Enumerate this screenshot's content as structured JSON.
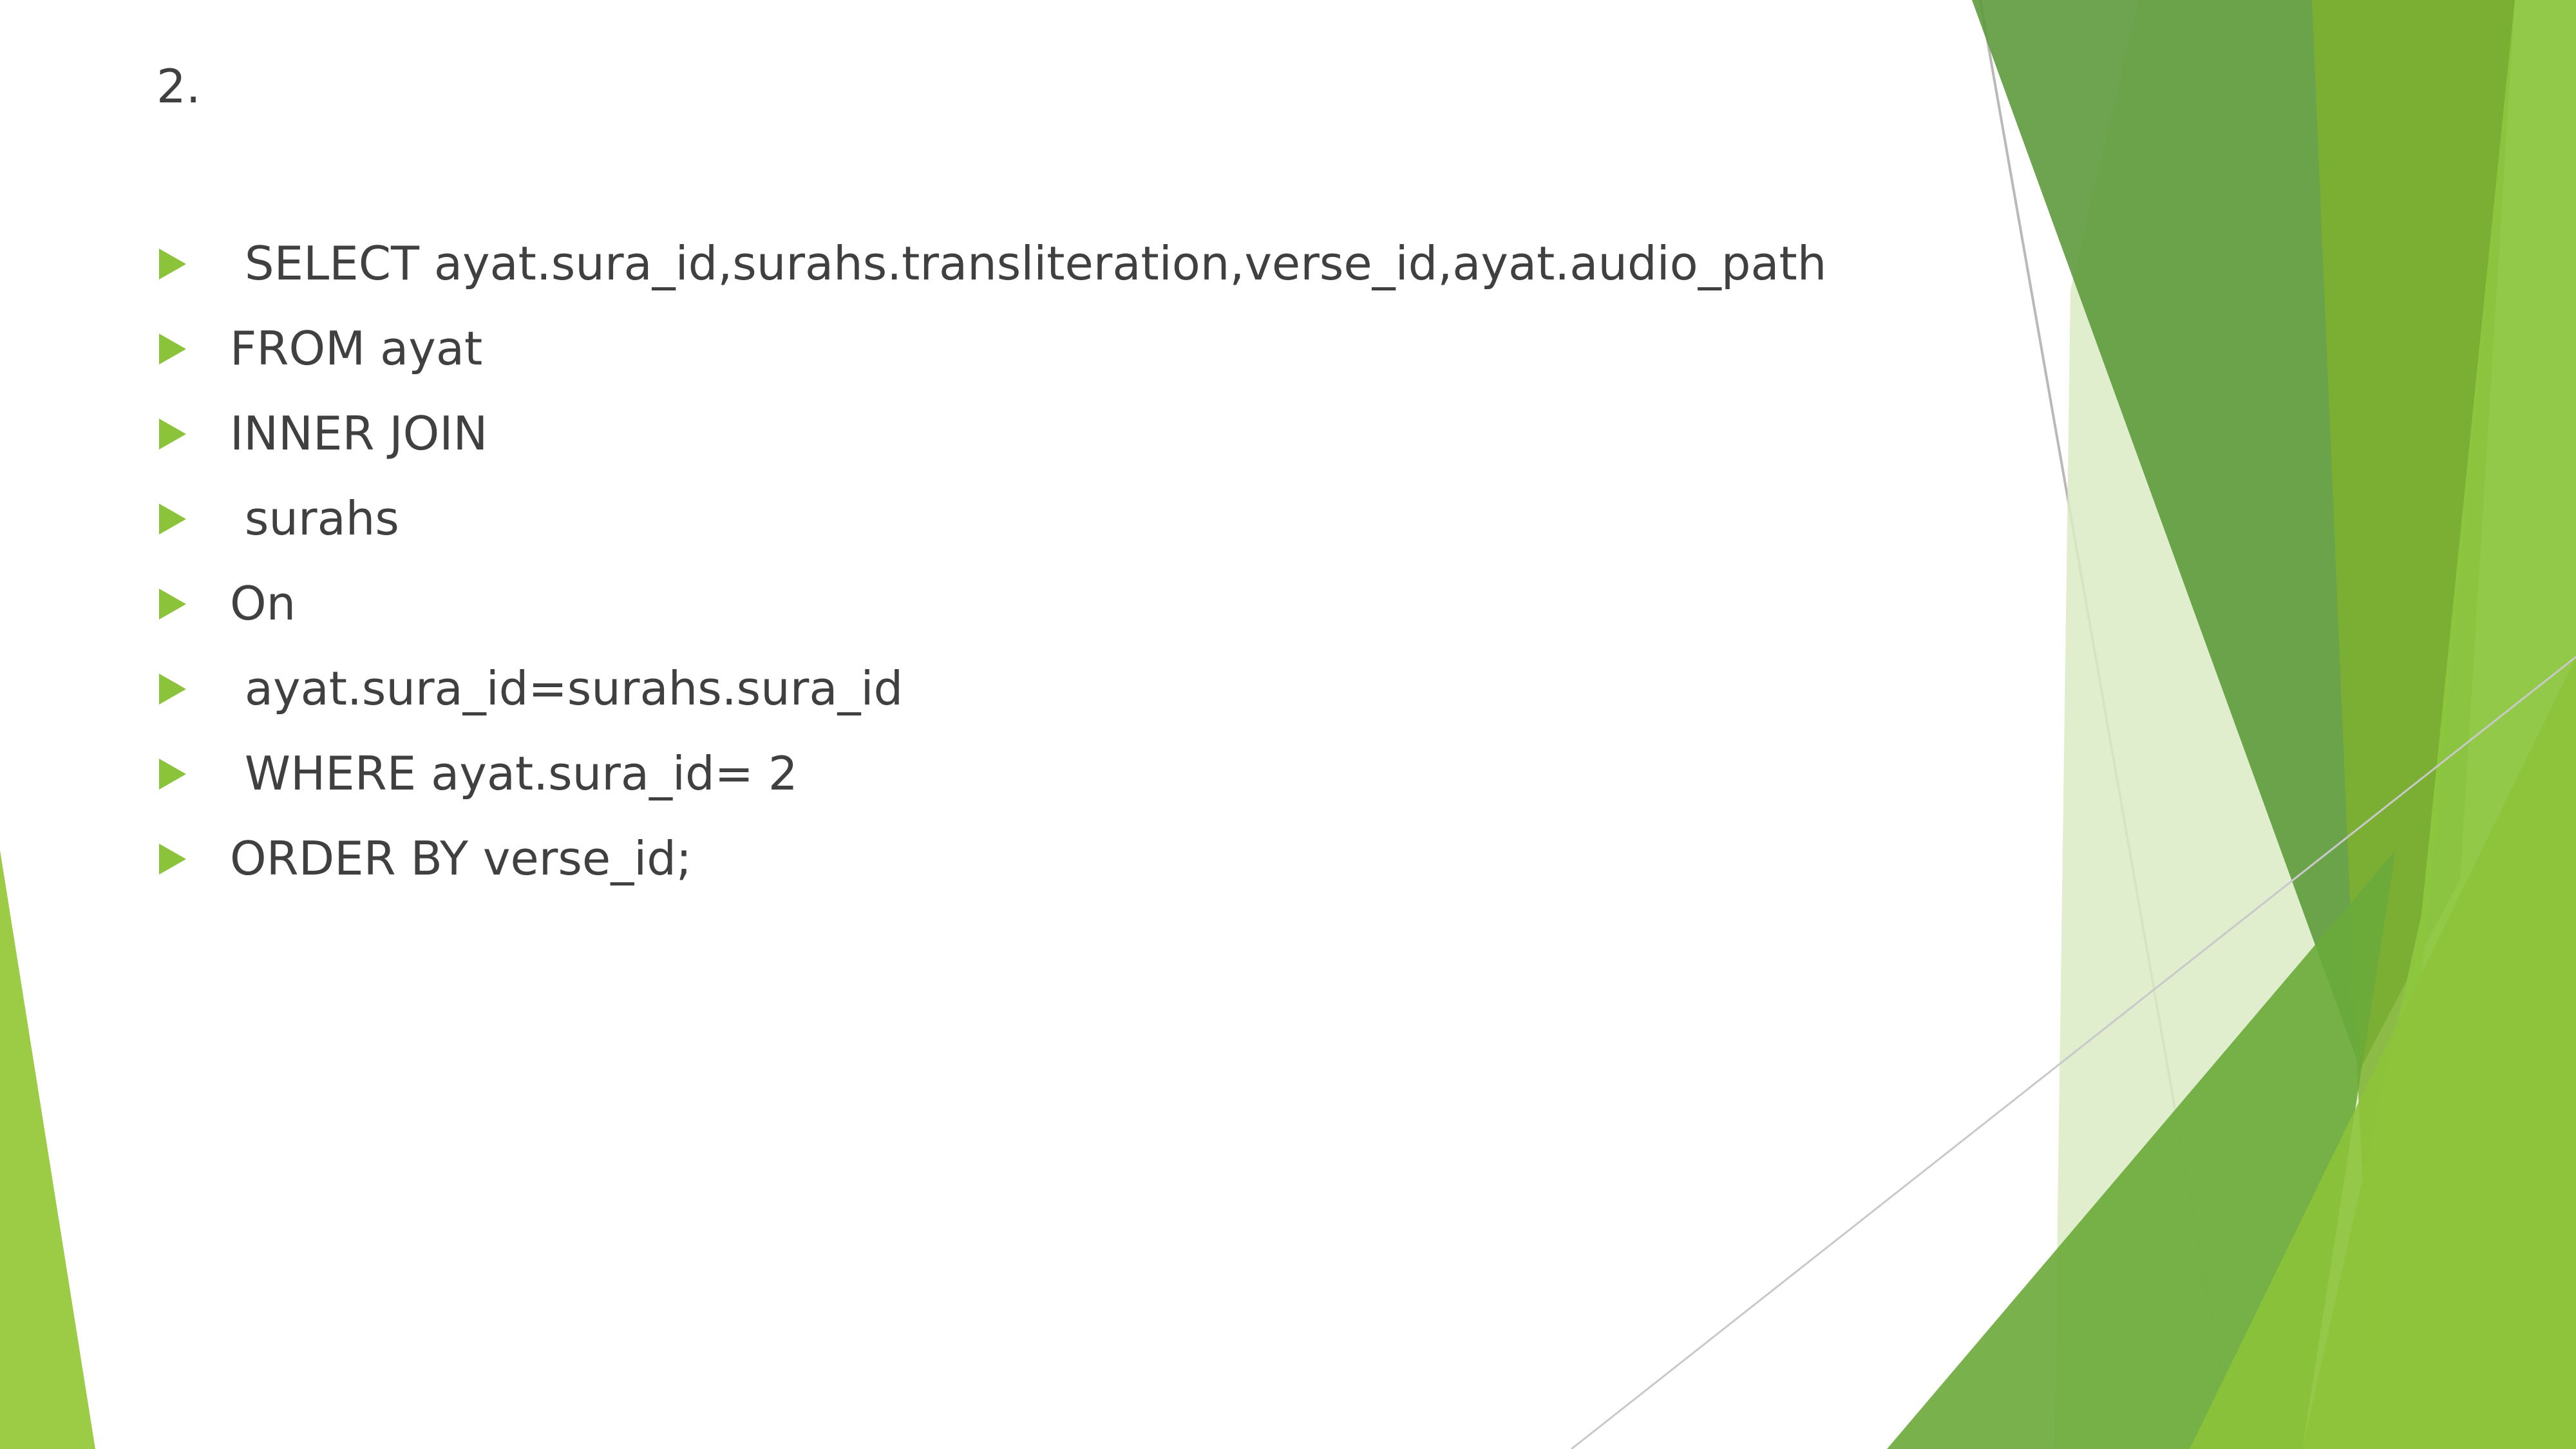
{
  "slide": {
    "title": "2.",
    "bullets": [
      " SELECT ayat.sura_id,surahs.transliteration,verse_id,ayat.audio_path",
      "FROM ayat",
      "INNER JOIN",
      " surahs",
      "On",
      " ayat.sura_id=surahs.sura_id",
      " WHERE ayat.sura_id= 2",
      "ORDER BY verse_id;"
    ]
  },
  "theme": {
    "bullet_color": "#8bc33a",
    "text_color": "#404040",
    "accent_dark_green": "#5e9a3c",
    "accent_light_green": "#8bc33a",
    "accent_pale_green": "#d6e8b8"
  }
}
